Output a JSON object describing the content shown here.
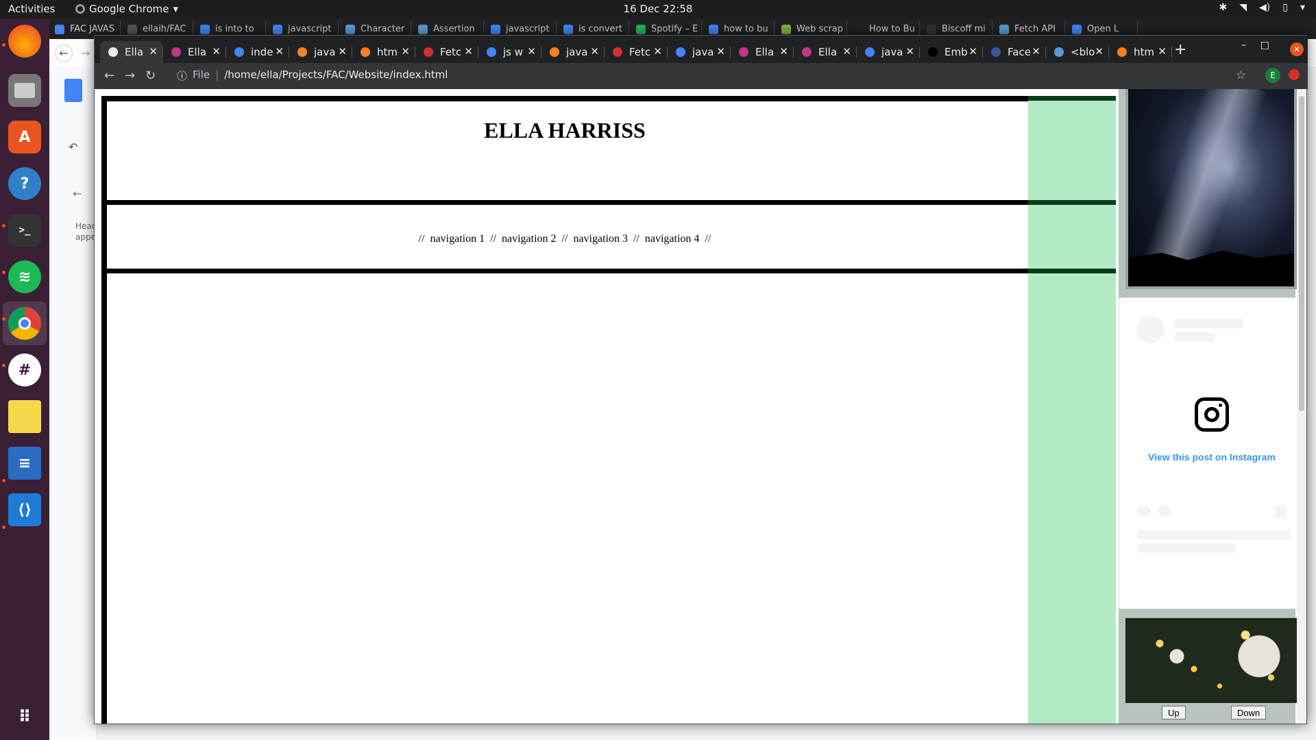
{
  "system": {
    "activities_label": "Activities",
    "app_name": "Google Chrome",
    "clock": "16 Dec  22:58"
  },
  "background_tabs": [
    {
      "label": "FAC JAVAS",
      "color": "#4285f4"
    },
    {
      "label": "ellaih/FAC",
      "color": "#555555"
    },
    {
      "label": "is into to",
      "color": "#4285f4"
    },
    {
      "label": "javascript",
      "color": "#4285f4"
    },
    {
      "label": "Character",
      "color": "#5b9bd5"
    },
    {
      "label": "Assertion",
      "color": "#5b9bd5"
    },
    {
      "label": "javascript",
      "color": "#4285f4"
    },
    {
      "label": "is convert",
      "color": "#4285f4"
    },
    {
      "label": "Spotify – E",
      "color": "#1db954"
    },
    {
      "label": "how to bu",
      "color": "#4285f4"
    },
    {
      "label": "Web scrap",
      "color": "#7cb342"
    },
    {
      "label": "How to Bu",
      "color": "#222222"
    },
    {
      "label": "Biscoff mi",
      "color": "#333333"
    },
    {
      "label": "Fetch API",
      "color": "#5b9bd5"
    },
    {
      "label": "Open L",
      "color": "#4285f4"
    }
  ],
  "tabs": [
    {
      "label": "Ella",
      "color": "#e8eaed"
    },
    {
      "label": "Ella",
      "color": "#c13584"
    },
    {
      "label": "inde",
      "color": "#4285f4"
    },
    {
      "label": "java",
      "color": "#f48024"
    },
    {
      "label": "htm",
      "color": "#f48024"
    },
    {
      "label": "Fetc",
      "color": "#d32f2f"
    },
    {
      "label": "js w",
      "color": "#4285f4"
    },
    {
      "label": "java",
      "color": "#f48024"
    },
    {
      "label": "Fetc",
      "color": "#d32f2f"
    },
    {
      "label": "java",
      "color": "#4285f4"
    },
    {
      "label": "Ella",
      "color": "#c13584"
    },
    {
      "label": "Ella",
      "color": "#c13584"
    },
    {
      "label": "java",
      "color": "#4285f4"
    },
    {
      "label": "Emb",
      "color": "#000000"
    },
    {
      "label": "Face",
      "color": "#3b5998"
    },
    {
      "label": "<blo",
      "color": "#5b9bd5"
    },
    {
      "label": "htm",
      "color": "#f48024"
    }
  ],
  "tab_icons": {
    "dev": "DEV",
    "fb": "FB"
  },
  "address_bar": {
    "scheme_label": "File",
    "url": "/home/ella/Projects/FAC/Website/index.html"
  },
  "profile_initial": "E",
  "site": {
    "title": "ELLA HARRISS",
    "nav": [
      "//",
      "navigation 1",
      "//",
      "navigation 2",
      "//",
      "navigation 3",
      "//",
      "navigation 4",
      "//"
    ]
  },
  "sidebar": {
    "instagram_link": "View this post on Instagram",
    "up_label": "Up",
    "down_label": "Down"
  },
  "background_doc": {
    "side_text_1": "Head",
    "side_text_2": "appe"
  }
}
